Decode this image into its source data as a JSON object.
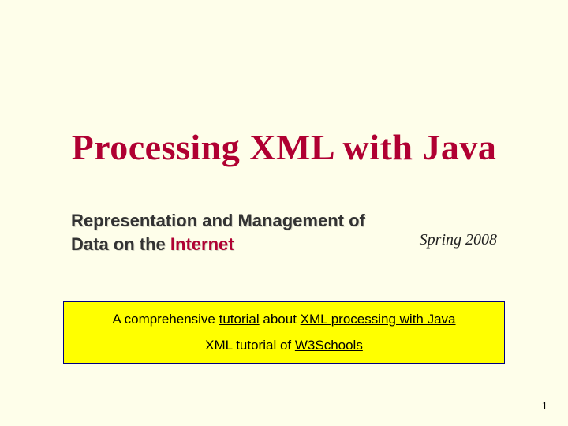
{
  "title": "Processing XML with Java",
  "subtitle": {
    "line_prefix": "Representation and Management of Data on the ",
    "line_emph": "Internet",
    "term": "Spring 2008"
  },
  "box": {
    "link1_pre": "A comprehensive ",
    "link1_u1": "tutorial",
    "link1_mid": " about ",
    "link1_u2": "XML processing with Java",
    "link2_pre": "XML tutorial of ",
    "link2_u": "W3Schools"
  },
  "page_number": "1"
}
